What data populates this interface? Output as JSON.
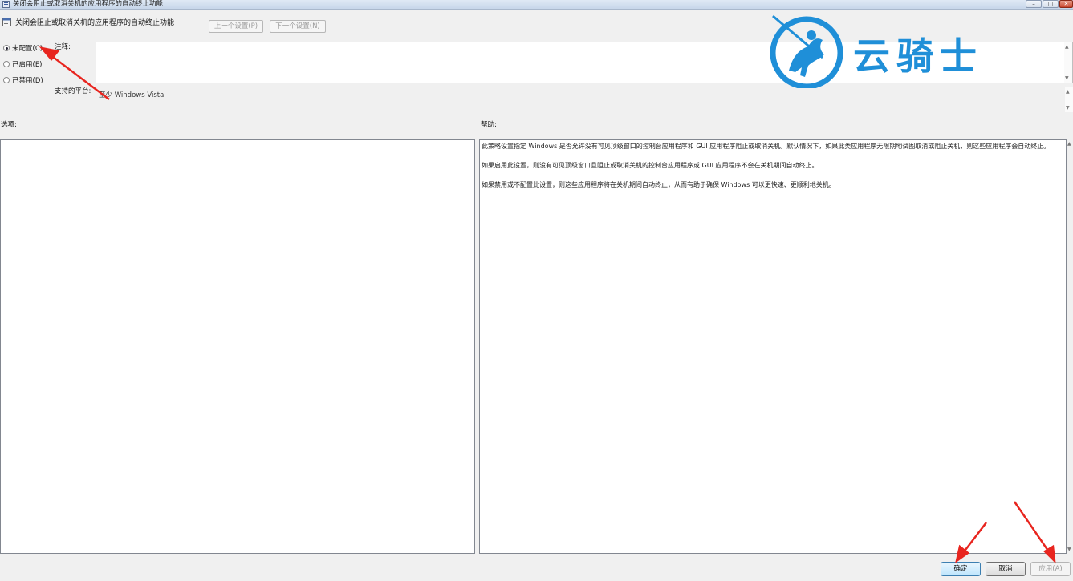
{
  "window": {
    "title": "关闭会阻止或取消关机的应用程序的自动终止功能",
    "minimize_glyph": "–",
    "maximize_glyph": "□",
    "close_glyph": "✕"
  },
  "header": {
    "policy_title": "关闭会阻止或取消关机的应用程序的自动终止功能",
    "prev_label": "上一个设置(P)",
    "next_label": "下一个设置(N)"
  },
  "state_options": [
    {
      "label": "未配置(C)",
      "checked": true
    },
    {
      "label": "已启用(E)",
      "checked": false
    },
    {
      "label": "已禁用(D)",
      "checked": false
    }
  ],
  "comment": {
    "label": "注释:",
    "value": ""
  },
  "platform": {
    "label": "支持的平台:",
    "value": "至少 Windows Vista"
  },
  "options": {
    "label": "选项:"
  },
  "help": {
    "label": "帮助:",
    "paragraphs": [
      "此策略设置指定 Windows 是否允许没有可见顶级窗口的控制台应用程序和 GUI 应用程序阻止或取消关机。默认情况下，如果此类应用程序无限期地试图取消或阻止关机，则这些应用程序会自动终止。",
      "如果启用此设置，则没有可见顶级窗口且阻止或取消关机的控制台应用程序或 GUI 应用程序不会在关机期间自动终止。",
      "如果禁用或不配置此设置，则这些应用程序将在关机期间自动终止，从而有助于确保 Windows 可以更快速、更顺利地关机。"
    ]
  },
  "buttons": {
    "ok": "确定",
    "cancel": "取消",
    "apply": "应用(A)"
  },
  "watermark": {
    "text": "云骑士"
  },
  "colors": {
    "watermark": "#1f8fd8",
    "annotation_arrow": "#e8251f"
  },
  "icons": {
    "app": "policy-window-icon",
    "policy": "policy-setting-icon",
    "watermark_logo": "knight-on-horse-icon",
    "annotations": "red-arrow-icon"
  }
}
